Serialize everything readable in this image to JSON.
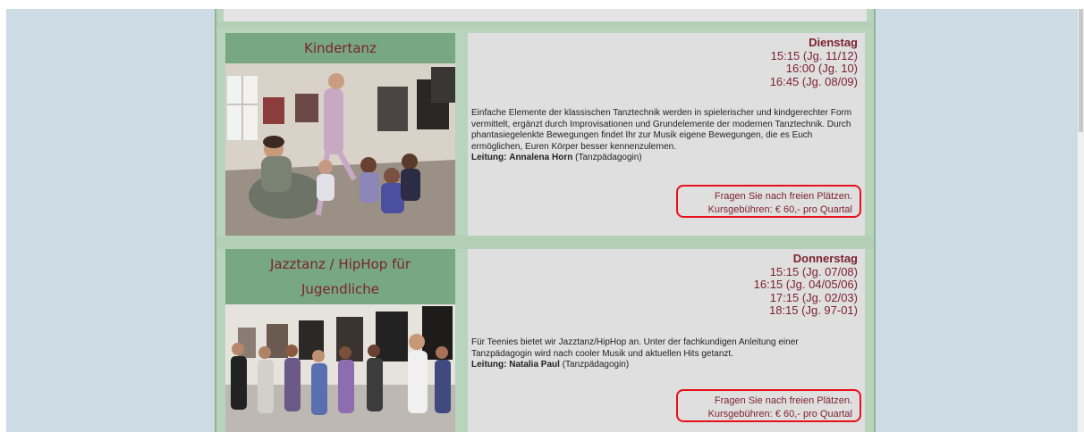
{
  "courses": [
    {
      "title": "Kindertanz",
      "day": "Dienstag",
      "times": [
        "15:15 (Jg. 11/12)",
        "16:00 (Jg. 10)",
        "16:45 (Jg. 08/09)"
      ],
      "description": "Einfache Elemente der klassischen Tanztechnik werden in spielerischer und kindgerechter Form vermittelt, ergänzt durch Improvisationen und Grundelemente der modernen Tanztechnik. Durch phantasiegelenkte Bewegungen findet Ihr zur Musik eigene Bewegungen, die es Euch ermöglichen, Euren Körper besser kennenzulernen.",
      "lead_label": "Leitung:",
      "lead_name": "Annalena Horn",
      "lead_role": "(Tanzpädagogin)",
      "fee_line1": "Fragen Sie nach freien Plätzen.",
      "fee_line2": "Kursgebühren: € 60,- pro Quartal"
    },
    {
      "title": "Jazztanz / HipHop für Jugendliche",
      "day": "Donnerstag",
      "times": [
        "15:15 (Jg. 07/08)",
        "16:15 (Jg. 04/05/06)",
        "17:15 (Jg. 02/03)",
        "18:15 (Jg. 97-01)"
      ],
      "description": "Für Teenies bietet wir Jazztanz/HipHop an. Unter der fachkundigen Anleitung einer Tanzpädagogin wird nach cooler Musik und aktuellen Hits getanzt.",
      "lead_label": "Leitung:",
      "lead_name": "Natalia Paul",
      "lead_role": "(Tanzpädagogin)",
      "fee_line1": "Fragen Sie nach freien Plätzen.",
      "fee_line2": "Kursgebühren: € 60,- pro Quartal"
    }
  ],
  "colors": {
    "title_text": "#7c2230",
    "title_bg": "#77a783",
    "highlight_border": "#e8101a",
    "page_bg": "#cddbe5",
    "column_bg": "#b8d4bc",
    "info_bg": "#dfdfdf"
  }
}
